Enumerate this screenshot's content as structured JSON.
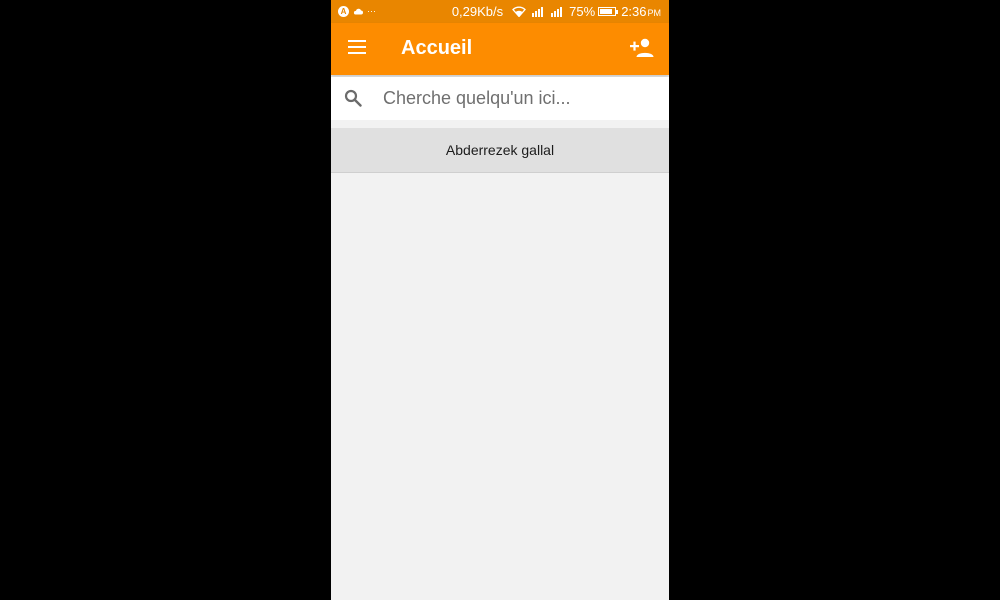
{
  "status_bar": {
    "notif_a": "A",
    "notif_more": "···",
    "net_speed": "0,29Kb/s",
    "battery_percent": "75%",
    "battery_level": 0.75,
    "time": "2:36",
    "ampm": "PM"
  },
  "app_bar": {
    "title": "Accueil",
    "menu_icon": "menu-icon",
    "add_icon": "person-add-icon"
  },
  "search": {
    "value": "",
    "placeholder": "Cherche quelqu'un ici..."
  },
  "users": [
    {
      "name": "Abderrezek gallal"
    }
  ],
  "colors": {
    "status_bar": "#e98600",
    "app_bar": "#fd8c00",
    "background": "#f2f2f2",
    "list_item": "#e0e0e0"
  }
}
